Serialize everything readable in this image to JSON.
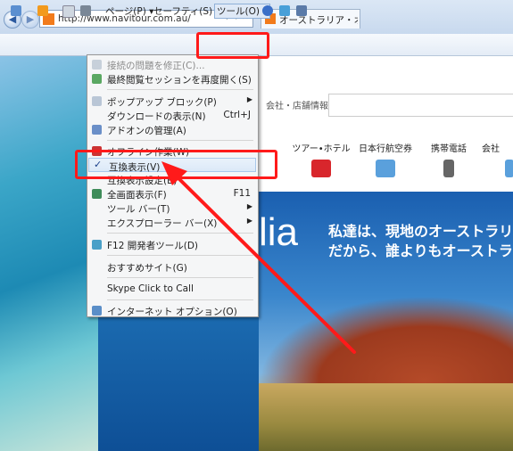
{
  "browser": {
    "back_label": "◀",
    "forward_label": "▶",
    "address_url": "http://www.navitour.com.au/",
    "address_tools": "⌕ ▾ ✕",
    "tab_title": "オーストラリア・オプショ…"
  },
  "command_bar": {
    "page_label": "ページ(P) ▾",
    "safety_label": "セーフティ(S) ▾",
    "tools_label": "ツール(O) ▾"
  },
  "tools_menu": {
    "items": [
      {
        "label": "接続の問題を修正(C)...",
        "shortcut": "",
        "disabled": true
      },
      {
        "label": "最終閲覧セッションを再度開く(S)",
        "shortcut": ""
      },
      {
        "label": "ポップアップ ブロック(P)",
        "shortcut": ""
      },
      {
        "label": "ダウンロードの表示(N)",
        "shortcut": "Ctrl+J"
      },
      {
        "label": "アドオンの管理(A)",
        "shortcut": ""
      },
      {
        "label": "オフライン作業(W)",
        "shortcut": ""
      },
      {
        "label": "互換表示(V)",
        "shortcut": "",
        "checked": true
      },
      {
        "label": "互換表示設定(B)",
        "shortcut": ""
      },
      {
        "label": "全画面表示(F)",
        "shortcut": "F11"
      },
      {
        "label": "ツール バー(T)",
        "shortcut": ""
      },
      {
        "label": "エクスプローラー バー(X)",
        "shortcut": ""
      },
      {
        "label": "F12 開発者ツール(D)",
        "shortcut": ""
      },
      {
        "label": "おすすめサイト(G)",
        "shortcut": ""
      },
      {
        "label": "Skype Click to Call",
        "shortcut": ""
      },
      {
        "label": "インターネット オプション(O)",
        "shortcut": ""
      }
    ],
    "check_mark": "✓",
    "submenu_arrow": "▶"
  },
  "site": {
    "search_hint": "会社・店舗情報",
    "nav": [
      "ツアー•ホテル",
      "日本行航空券",
      "携帯電話",
      "会社"
    ],
    "hero_logo_fragment": "lia",
    "hero_line1": "私達は、現地のオーストラリ",
    "hero_line2": "だから、誰よりもオーストラ"
  },
  "colors": {
    "annotation_red": "#ff1a1a",
    "brand_orange": "#f27b1b"
  }
}
